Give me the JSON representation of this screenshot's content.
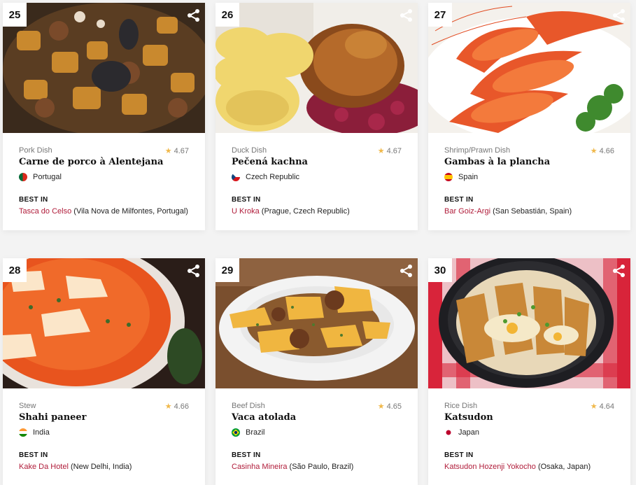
{
  "cards": [
    {
      "rank": "25",
      "category": "Pork Dish",
      "rating": "4.67",
      "name": "Carne de porco à Alentejana",
      "country": "Portugal",
      "best_label": "BEST IN",
      "restaurant": "Tasca do Celso",
      "location": " (Vila Nova de Milfontes, Portugal)",
      "share_icon": "share-icon",
      "flag_colors": [
        "#046a38",
        "#da291c"
      ]
    },
    {
      "rank": "26",
      "category": "Duck Dish",
      "rating": "4.67",
      "name": "Pečená kachna",
      "country": "Czech Republic",
      "best_label": "BEST IN",
      "restaurant": "U Kroka",
      "location": " (Prague, Czech Republic)",
      "share_icon": "share-icon",
      "flag_colors": [
        "#ffffff",
        "#d7141a",
        "#11457e"
      ]
    },
    {
      "rank": "27",
      "category": "Shrimp/Prawn Dish",
      "rating": "4.66",
      "name": "Gambas à la plancha",
      "country": "Spain",
      "best_label": "BEST IN",
      "restaurant": "Bar Goiz-Argi",
      "location": " (San Sebastián, Spain)",
      "share_icon": "share-icon",
      "flag_colors": [
        "#c60b1e",
        "#ffc400"
      ]
    },
    {
      "rank": "28",
      "category": "Stew",
      "rating": "4.66",
      "name": "Shahi paneer",
      "country": "India",
      "best_label": "BEST IN",
      "restaurant": "Kake Da Hotel",
      "location": " (New Delhi, India)",
      "share_icon": "share-icon",
      "flag_colors": [
        "#ff9933",
        "#ffffff",
        "#138808"
      ]
    },
    {
      "rank": "29",
      "category": "Beef Dish",
      "rating": "4.65",
      "name": "Vaca atolada",
      "country": "Brazil",
      "best_label": "BEST IN",
      "restaurant": "Casinha Mineira",
      "location": " (São Paulo, Brazil)",
      "share_icon": "share-icon",
      "flag_colors": [
        "#009c3b",
        "#ffdf00",
        "#002776"
      ]
    },
    {
      "rank": "30",
      "category": "Rice Dish",
      "rating": "4.64",
      "name": "Katsudon",
      "country": "Japan",
      "best_label": "BEST IN",
      "restaurant": "Katsudon Hozenji Yokocho",
      "location": " (Osaka, Japan)",
      "share_icon": "share-icon",
      "flag_colors": [
        "#ffffff",
        "#bc002d"
      ]
    }
  ],
  "colors": {
    "link": "#b01c3a",
    "star": "#f0b84a"
  }
}
